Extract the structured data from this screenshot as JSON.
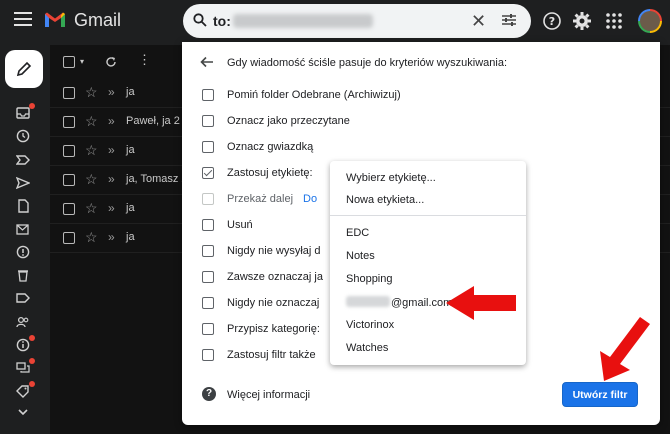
{
  "app": {
    "brand": "Gmail"
  },
  "search": {
    "query_prefix": "to:"
  },
  "mail_list": {
    "rows": [
      {
        "sender": "ja"
      },
      {
        "sender": "Paweł, ja 2"
      },
      {
        "sender": "ja"
      },
      {
        "sender": "ja, Tomasz 2"
      },
      {
        "sender": "ja"
      },
      {
        "sender": "ja"
      }
    ]
  },
  "filter_dialog": {
    "title": "Gdy wiadomość ściśle pasuje do kryteriów wyszukiwania:",
    "options": [
      {
        "label": "Pomiń folder Odebrane (Archiwizuj)",
        "checked": false,
        "disabled": false
      },
      {
        "label": "Oznacz jako przeczytane",
        "checked": false,
        "disabled": false
      },
      {
        "label": "Oznacz gwiazdką",
        "checked": false,
        "disabled": false
      },
      {
        "label": "Zastosuj etykietę:",
        "checked": true,
        "disabled": false
      },
      {
        "label": "Przekaż dalej",
        "checked": false,
        "disabled": true,
        "link": "Do"
      },
      {
        "label": "Usuń",
        "checked": false,
        "disabled": false
      },
      {
        "label": "Nigdy nie wysyłaj d",
        "checked": false,
        "disabled": false
      },
      {
        "label": "Zawsze oznaczaj ja",
        "checked": false,
        "disabled": false
      },
      {
        "label": "Nigdy nie oznaczaj",
        "checked": false,
        "disabled": false
      },
      {
        "label": "Przypisz kategorię:",
        "checked": false,
        "disabled": false
      },
      {
        "label": "Zastosuj filtr także",
        "checked": false,
        "disabled": false
      }
    ],
    "more_info": "Więcej informacji",
    "create_button": "Utwórz filtr"
  },
  "label_menu": {
    "items": [
      {
        "label": "Wybierz etykietę..."
      },
      {
        "label": "Nowa etykieta..."
      },
      {
        "label": "EDC"
      },
      {
        "label": "Notes"
      },
      {
        "label": "Shopping"
      },
      {
        "label": "@gmail.com"
      },
      {
        "label": "Victorinox"
      },
      {
        "label": "Watches"
      }
    ]
  },
  "colors": {
    "accent": "#1a73e8",
    "annotation_arrow": "#e8100f",
    "dark_bg": "#1e1f20"
  }
}
